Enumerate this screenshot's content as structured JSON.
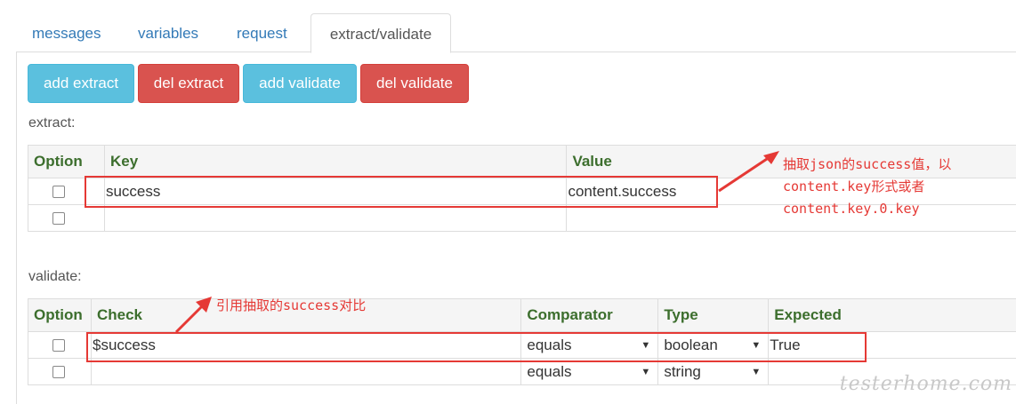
{
  "tabs": [
    {
      "label": "messages",
      "active": false
    },
    {
      "label": "variables",
      "active": false
    },
    {
      "label": "request",
      "active": false
    },
    {
      "label": "extract/validate",
      "active": true
    }
  ],
  "toolbar": {
    "add_extract": "add extract",
    "del_extract": "del extract",
    "add_validate": "add validate",
    "del_validate": "del validate"
  },
  "extract": {
    "label": "extract:",
    "headers": {
      "option": "Option",
      "key": "Key",
      "value": "Value"
    },
    "rows": [
      {
        "key": "success",
        "value": "content.success"
      },
      {
        "key": "",
        "value": ""
      }
    ],
    "annotation": "抽取json的success值，以\ncontent.key形式或者\ncontent.key.0.key"
  },
  "validate": {
    "label": "validate:",
    "headers": {
      "option": "Option",
      "check": "Check",
      "comparator": "Comparator",
      "type": "Type",
      "expected": "Expected"
    },
    "rows": [
      {
        "check": "$success",
        "comparator": "equals",
        "type": "boolean",
        "expected": "True"
      },
      {
        "check": "",
        "comparator": "equals",
        "type": "string",
        "expected": ""
      }
    ],
    "annotation": "引用抽取的success对比"
  },
  "colors": {
    "info": "#5bc0de",
    "danger": "#d9534f",
    "annotation": "#e53935",
    "header_text": "#3c6e2d"
  },
  "watermark": "testerhome.com"
}
